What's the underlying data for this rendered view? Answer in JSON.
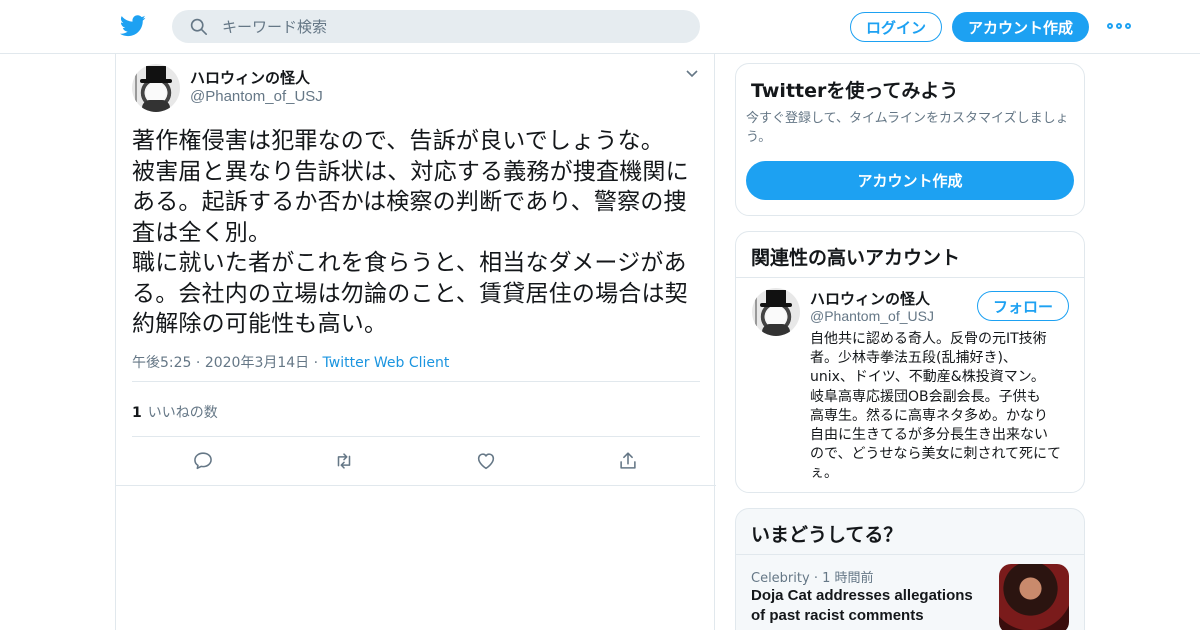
{
  "header": {
    "search_placeholder": "キーワード検索",
    "login_label": "ログイン",
    "signup_label": "アカウント作成"
  },
  "tweet": {
    "author_name": "ハロウィンの怪人",
    "author_handle": "@Phantom_of_USJ",
    "text": "著作権侵害は犯罪なので、告訴が良いでしょうな。\n被害届と異なり告訴状は、対応する義務が捜査機関に\nある。起訴するか否かは検察の判断であり、警察の捜\n査は全く別。\n職に就いた者がこれを食らうと、相当なダメージがあ\nる。会社内の立場は勿論のこと、賃貸居住の場合は契\n約解除の可能性も高い。",
    "time": "午後5:25",
    "date": "2020年3月14日",
    "client": "Twitter Web Client",
    "likes_count": "1",
    "likes_label": "いいねの数"
  },
  "try_twitter": {
    "title": "Twitterを使ってみよう",
    "description": "今すぐ登録して、タイムラインをカスタマイズしましょう。",
    "button_label": "アカウント作成"
  },
  "relevant": {
    "title": "関連性の高いアカウント",
    "name": "ハロウィンの怪人",
    "handle": "@Phantom_of_USJ",
    "follow_label": "フォロー",
    "bio": "自他共に認める奇人。反骨の元IT技術\n者。少林寺拳法五段(乱捕好き)、\nunix、ドイツ、不動産&株投資マン。\n岐阜高専応援団OB会副会長。子供も\n高専生。然るに高専ネタ多め。かなり\n自由に生きてるが多分長生き出来ない\nので、どうせなら美女に刺されて死にて\nぇ。"
  },
  "trends": {
    "title": "いまどうしてる？",
    "category": "Celebrity",
    "time": "1 時間前",
    "headline": "Doja Cat addresses allegations of past racist comments"
  },
  "colors": {
    "accent": "#1da1f2",
    "text": "#14171a",
    "muted": "#657786",
    "border": "#e1e8ed"
  }
}
